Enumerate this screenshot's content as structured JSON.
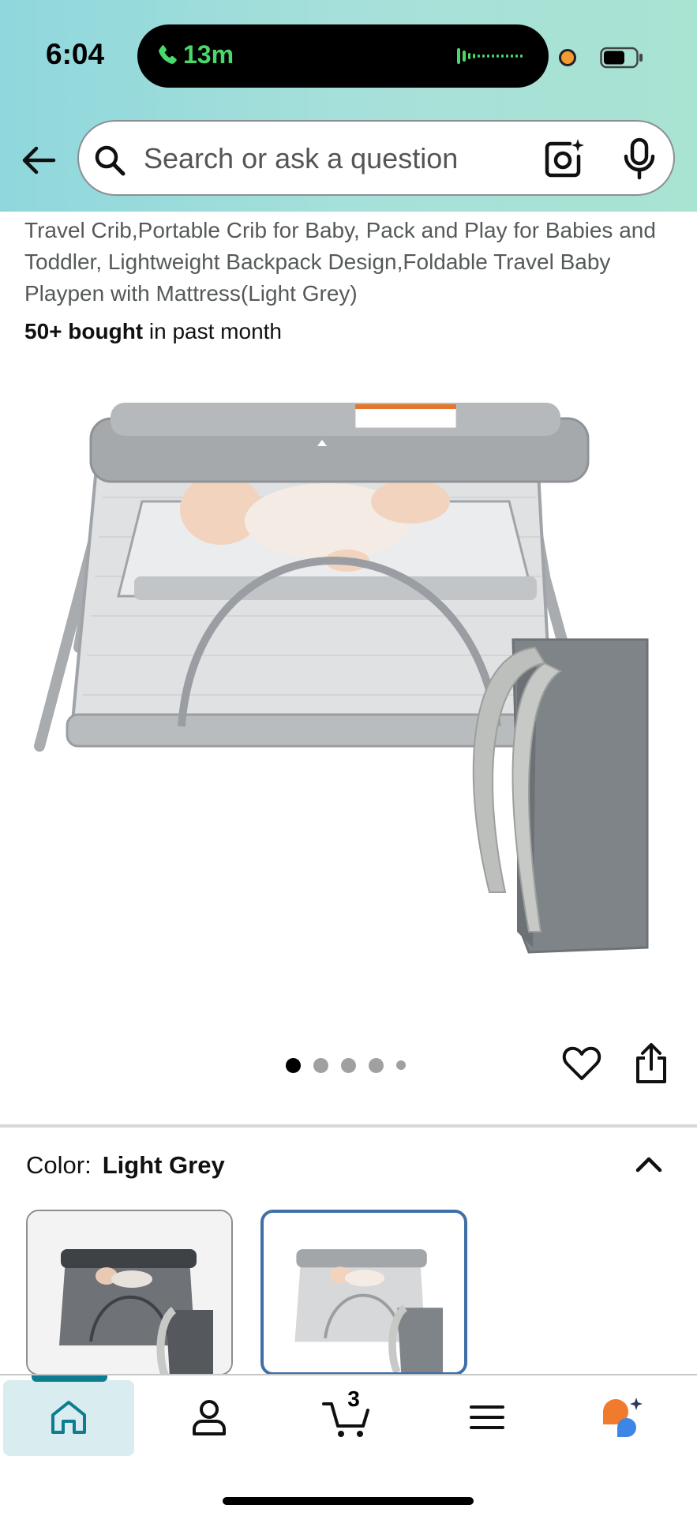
{
  "status_bar": {
    "time": "6:04",
    "call_duration": "13m",
    "battery_icon": "battery-icon",
    "colors": {
      "call_green": "#49d86a",
      "privacy_dot": "#f39a32"
    }
  },
  "header": {
    "back_icon": "arrow-left-icon",
    "search": {
      "placeholder": "Search or ask a question",
      "icons": [
        "search-icon",
        "camera-lens-icon",
        "microphone-icon"
      ]
    },
    "gradient_colors": [
      "#8fd7dc",
      "#a9e3d2"
    ]
  },
  "product": {
    "title": "Travel Crib,Portable Crib for Baby, Pack and Play for Babies and Toddler, Lightweight Backpack Design,Foldable Travel Baby Playpen with Mattress(Light Grey)",
    "bought_bold": "50+ bought",
    "bought_rest": " in past month",
    "image_carousel": {
      "total_dots": 5,
      "active_index": 0
    },
    "actions": [
      "heart-icon",
      "share-icon"
    ]
  },
  "variation": {
    "label": "Color:",
    "selected": "Light Grey",
    "options": [
      {
        "name": "dark-grey-swatch",
        "selected": false
      },
      {
        "name": "light-grey-swatch",
        "selected": true
      }
    ],
    "selected_border_color": "#3f6fa8"
  },
  "bottom_nav": {
    "items": [
      {
        "name": "home",
        "icon": "home-icon",
        "active": true
      },
      {
        "name": "account",
        "icon": "person-icon",
        "active": false
      },
      {
        "name": "cart",
        "icon": "cart-icon",
        "active": false
      },
      {
        "name": "menu",
        "icon": "hamburger-menu-icon",
        "active": false
      },
      {
        "name": "rufus",
        "icon": "rufus-assistant-icon",
        "active": false
      }
    ],
    "cart_count": "3",
    "active_color": "#0d7d8f"
  }
}
